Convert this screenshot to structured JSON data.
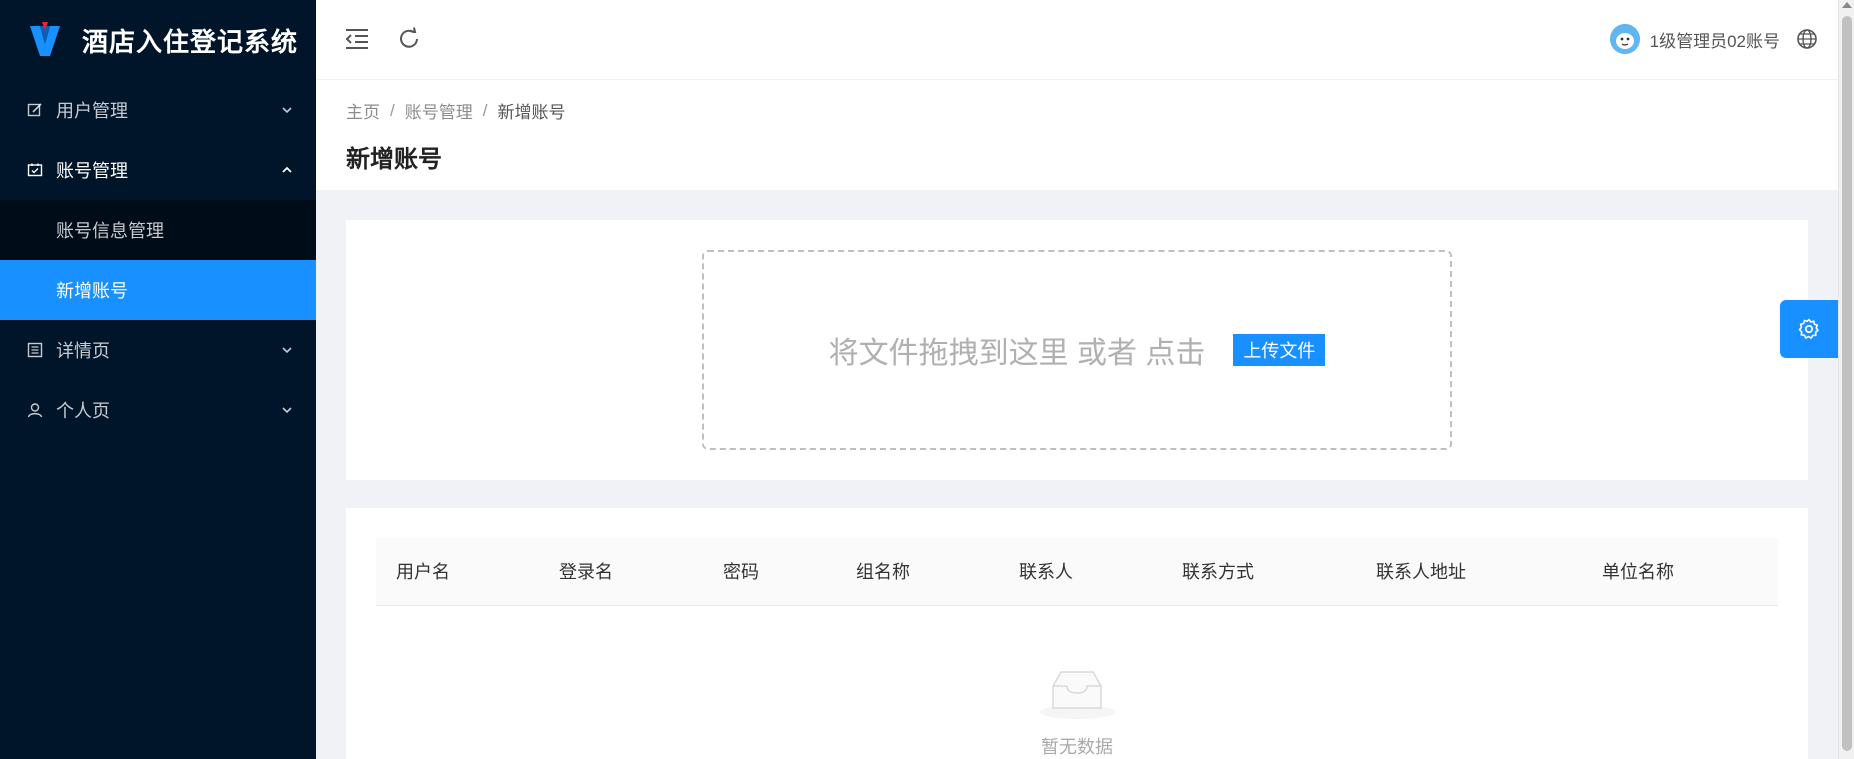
{
  "app": {
    "title": "酒店入住登记系统"
  },
  "sidebar": {
    "items": [
      {
        "label": "用户管理",
        "icon": "edit-icon",
        "expanded": false
      },
      {
        "label": "账号管理",
        "icon": "calendar-check-icon",
        "expanded": true,
        "children": [
          {
            "label": "账号信息管理",
            "active": false
          },
          {
            "label": "新增账号",
            "active": true
          }
        ]
      },
      {
        "label": "详情页",
        "icon": "profile-icon",
        "expanded": false
      },
      {
        "label": "个人页",
        "icon": "user-icon",
        "expanded": false
      }
    ]
  },
  "header": {
    "user_name": "1级管理员02账号",
    "icons": [
      "menu-fold-icon",
      "reload-icon",
      "globe-icon"
    ]
  },
  "breadcrumb": [
    "主页",
    "账号管理",
    "新增账号"
  ],
  "breadcrumb_sep": "/",
  "page": {
    "title": "新增账号"
  },
  "upload": {
    "hint": "将文件拖拽到这里 或者 点击",
    "button_label": "上传文件"
  },
  "table": {
    "columns": [
      "用户名",
      "登录名",
      "密码",
      "组名称",
      "联系人",
      "联系方式",
      "联系人地址",
      "单位名称"
    ],
    "rows": [],
    "empty_text": "暂无数据"
  },
  "colors": {
    "primary": "#1890ff",
    "sidebar_bg": "#001529",
    "submenu_bg": "#000c17",
    "page_bg": "#f0f2f5"
  }
}
